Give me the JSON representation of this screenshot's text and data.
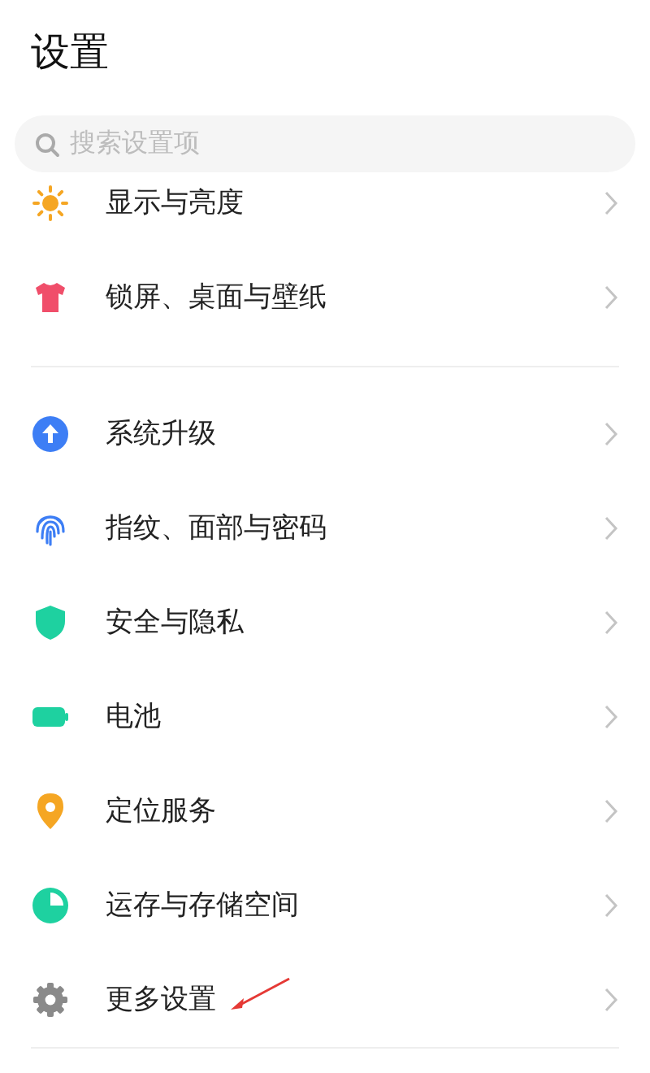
{
  "title": "设置",
  "search": {
    "placeholder": "搜索设置项"
  },
  "sections": [
    {
      "items": [
        {
          "label": "显示与亮度"
        },
        {
          "label": "锁屏、桌面与壁纸"
        }
      ]
    },
    {
      "items": [
        {
          "label": "系统升级"
        },
        {
          "label": "指纹、面部与密码"
        },
        {
          "label": "安全与隐私"
        },
        {
          "label": "电池"
        },
        {
          "label": "定位服务"
        },
        {
          "label": "运存与存储空间"
        },
        {
          "label": "更多设置"
        }
      ]
    }
  ]
}
